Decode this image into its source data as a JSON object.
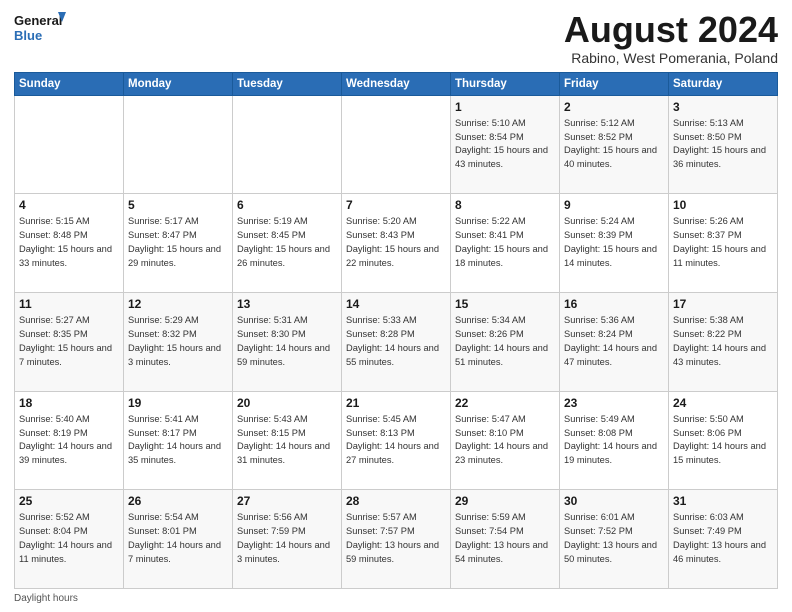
{
  "logo": {
    "line1": "General",
    "line2": "Blue"
  },
  "title": "August 2024",
  "subtitle": "Rabino, West Pomerania, Poland",
  "days_of_week": [
    "Sunday",
    "Monday",
    "Tuesday",
    "Wednesday",
    "Thursday",
    "Friday",
    "Saturday"
  ],
  "footer": "Daylight hours",
  "weeks": [
    [
      {
        "day": "",
        "sunrise": "",
        "sunset": "",
        "daylight": ""
      },
      {
        "day": "",
        "sunrise": "",
        "sunset": "",
        "daylight": ""
      },
      {
        "day": "",
        "sunrise": "",
        "sunset": "",
        "daylight": ""
      },
      {
        "day": "",
        "sunrise": "",
        "sunset": "",
        "daylight": ""
      },
      {
        "day": "1",
        "sunrise": "Sunrise: 5:10 AM",
        "sunset": "Sunset: 8:54 PM",
        "daylight": "Daylight: 15 hours and 43 minutes."
      },
      {
        "day": "2",
        "sunrise": "Sunrise: 5:12 AM",
        "sunset": "Sunset: 8:52 PM",
        "daylight": "Daylight: 15 hours and 40 minutes."
      },
      {
        "day": "3",
        "sunrise": "Sunrise: 5:13 AM",
        "sunset": "Sunset: 8:50 PM",
        "daylight": "Daylight: 15 hours and 36 minutes."
      }
    ],
    [
      {
        "day": "4",
        "sunrise": "Sunrise: 5:15 AM",
        "sunset": "Sunset: 8:48 PM",
        "daylight": "Daylight: 15 hours and 33 minutes."
      },
      {
        "day": "5",
        "sunrise": "Sunrise: 5:17 AM",
        "sunset": "Sunset: 8:47 PM",
        "daylight": "Daylight: 15 hours and 29 minutes."
      },
      {
        "day": "6",
        "sunrise": "Sunrise: 5:19 AM",
        "sunset": "Sunset: 8:45 PM",
        "daylight": "Daylight: 15 hours and 26 minutes."
      },
      {
        "day": "7",
        "sunrise": "Sunrise: 5:20 AM",
        "sunset": "Sunset: 8:43 PM",
        "daylight": "Daylight: 15 hours and 22 minutes."
      },
      {
        "day": "8",
        "sunrise": "Sunrise: 5:22 AM",
        "sunset": "Sunset: 8:41 PM",
        "daylight": "Daylight: 15 hours and 18 minutes."
      },
      {
        "day": "9",
        "sunrise": "Sunrise: 5:24 AM",
        "sunset": "Sunset: 8:39 PM",
        "daylight": "Daylight: 15 hours and 14 minutes."
      },
      {
        "day": "10",
        "sunrise": "Sunrise: 5:26 AM",
        "sunset": "Sunset: 8:37 PM",
        "daylight": "Daylight: 15 hours and 11 minutes."
      }
    ],
    [
      {
        "day": "11",
        "sunrise": "Sunrise: 5:27 AM",
        "sunset": "Sunset: 8:35 PM",
        "daylight": "Daylight: 15 hours and 7 minutes."
      },
      {
        "day": "12",
        "sunrise": "Sunrise: 5:29 AM",
        "sunset": "Sunset: 8:32 PM",
        "daylight": "Daylight: 15 hours and 3 minutes."
      },
      {
        "day": "13",
        "sunrise": "Sunrise: 5:31 AM",
        "sunset": "Sunset: 8:30 PM",
        "daylight": "Daylight: 14 hours and 59 minutes."
      },
      {
        "day": "14",
        "sunrise": "Sunrise: 5:33 AM",
        "sunset": "Sunset: 8:28 PM",
        "daylight": "Daylight: 14 hours and 55 minutes."
      },
      {
        "day": "15",
        "sunrise": "Sunrise: 5:34 AM",
        "sunset": "Sunset: 8:26 PM",
        "daylight": "Daylight: 14 hours and 51 minutes."
      },
      {
        "day": "16",
        "sunrise": "Sunrise: 5:36 AM",
        "sunset": "Sunset: 8:24 PM",
        "daylight": "Daylight: 14 hours and 47 minutes."
      },
      {
        "day": "17",
        "sunrise": "Sunrise: 5:38 AM",
        "sunset": "Sunset: 8:22 PM",
        "daylight": "Daylight: 14 hours and 43 minutes."
      }
    ],
    [
      {
        "day": "18",
        "sunrise": "Sunrise: 5:40 AM",
        "sunset": "Sunset: 8:19 PM",
        "daylight": "Daylight: 14 hours and 39 minutes."
      },
      {
        "day": "19",
        "sunrise": "Sunrise: 5:41 AM",
        "sunset": "Sunset: 8:17 PM",
        "daylight": "Daylight: 14 hours and 35 minutes."
      },
      {
        "day": "20",
        "sunrise": "Sunrise: 5:43 AM",
        "sunset": "Sunset: 8:15 PM",
        "daylight": "Daylight: 14 hours and 31 minutes."
      },
      {
        "day": "21",
        "sunrise": "Sunrise: 5:45 AM",
        "sunset": "Sunset: 8:13 PM",
        "daylight": "Daylight: 14 hours and 27 minutes."
      },
      {
        "day": "22",
        "sunrise": "Sunrise: 5:47 AM",
        "sunset": "Sunset: 8:10 PM",
        "daylight": "Daylight: 14 hours and 23 minutes."
      },
      {
        "day": "23",
        "sunrise": "Sunrise: 5:49 AM",
        "sunset": "Sunset: 8:08 PM",
        "daylight": "Daylight: 14 hours and 19 minutes."
      },
      {
        "day": "24",
        "sunrise": "Sunrise: 5:50 AM",
        "sunset": "Sunset: 8:06 PM",
        "daylight": "Daylight: 14 hours and 15 minutes."
      }
    ],
    [
      {
        "day": "25",
        "sunrise": "Sunrise: 5:52 AM",
        "sunset": "Sunset: 8:04 PM",
        "daylight": "Daylight: 14 hours and 11 minutes."
      },
      {
        "day": "26",
        "sunrise": "Sunrise: 5:54 AM",
        "sunset": "Sunset: 8:01 PM",
        "daylight": "Daylight: 14 hours and 7 minutes."
      },
      {
        "day": "27",
        "sunrise": "Sunrise: 5:56 AM",
        "sunset": "Sunset: 7:59 PM",
        "daylight": "Daylight: 14 hours and 3 minutes."
      },
      {
        "day": "28",
        "sunrise": "Sunrise: 5:57 AM",
        "sunset": "Sunset: 7:57 PM",
        "daylight": "Daylight: 13 hours and 59 minutes."
      },
      {
        "day": "29",
        "sunrise": "Sunrise: 5:59 AM",
        "sunset": "Sunset: 7:54 PM",
        "daylight": "Daylight: 13 hours and 54 minutes."
      },
      {
        "day": "30",
        "sunrise": "Sunrise: 6:01 AM",
        "sunset": "Sunset: 7:52 PM",
        "daylight": "Daylight: 13 hours and 50 minutes."
      },
      {
        "day": "31",
        "sunrise": "Sunrise: 6:03 AM",
        "sunset": "Sunset: 7:49 PM",
        "daylight": "Daylight: 13 hours and 46 minutes."
      }
    ]
  ]
}
